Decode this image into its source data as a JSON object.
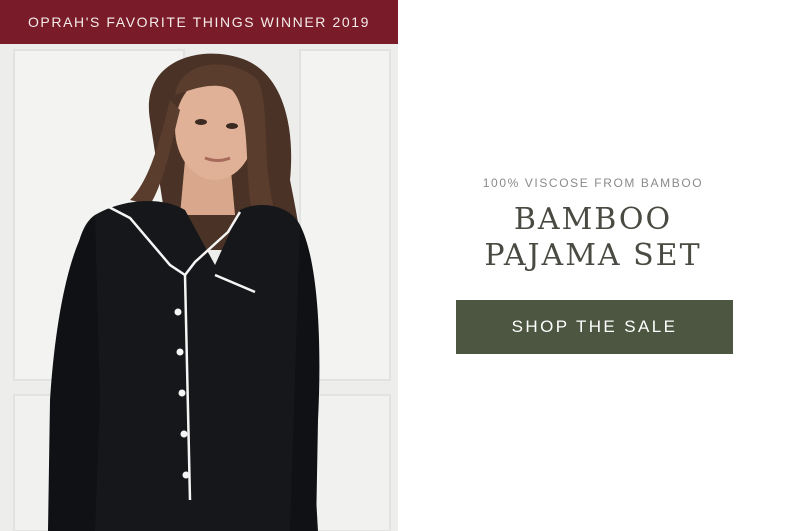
{
  "award": {
    "label": "OPRAH'S FAVORITE THINGS WINNER 2019"
  },
  "product": {
    "eyebrow": "100% VISCOSE FROM BAMBOO",
    "headline_line1": "BAMBOO",
    "headline_line2": "PAJAMA SET"
  },
  "cta": {
    "label": "SHOP THE SALE"
  },
  "colors": {
    "ribbon": "#7a1b2a",
    "button": "#4d5641",
    "headline": "#4a4a42",
    "eyebrow": "#8a8a8a"
  },
  "image": {
    "subject": "model-in-black-pajama-shirt"
  }
}
